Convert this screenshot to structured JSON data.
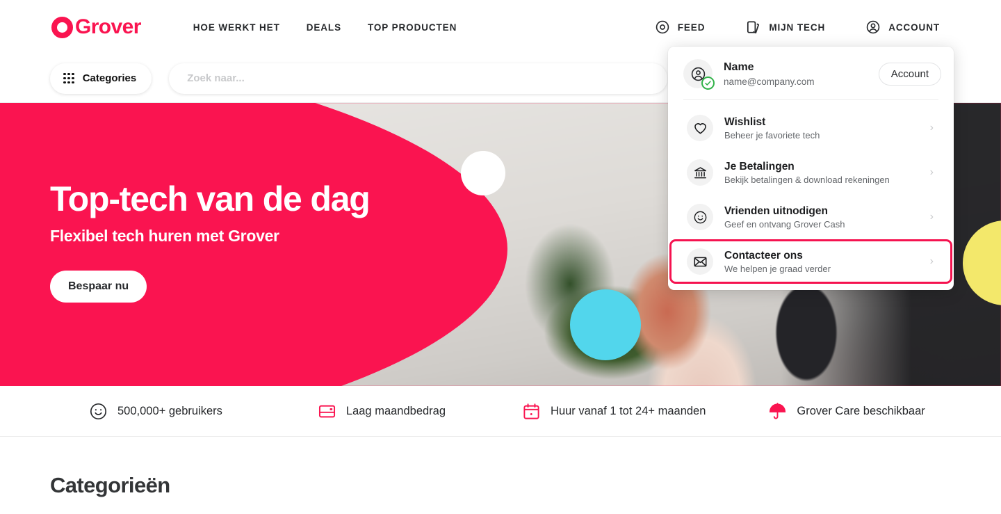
{
  "brand": {
    "name": "Grover",
    "logo_icon": "grover-ring-logo",
    "pink": "#FA1450",
    "cyan": "#52D6EC",
    "yellow": "#F3E86B",
    "highlight": "#F5124F"
  },
  "header": {
    "nav": [
      {
        "label": "HOE WERKT HET"
      },
      {
        "label": "DEALS"
      },
      {
        "label": "TOP PRODUCTEN"
      }
    ],
    "right": [
      {
        "label": "FEED",
        "icon": "feed-icon"
      },
      {
        "label": "MIJN TECH",
        "icon": "cards-icon"
      },
      {
        "label": "ACCOUNT",
        "icon": "account-icon"
      }
    ]
  },
  "searchbar": {
    "categories_label": "Categories",
    "categories_icon": "grid-dots-icon",
    "placeholder": "Zoek naar...",
    "value": ""
  },
  "hero": {
    "title": "Top-tech van de dag",
    "subtitle": "Flexibel tech huren met Grover",
    "cta": "Bespaar nu"
  },
  "features": [
    {
      "label": "500,000+ gebruikers",
      "icon": "smiley-icon",
      "color": "#26282B"
    },
    {
      "label": "Laag maandbedrag",
      "icon": "card-icon",
      "color": "#FA1450"
    },
    {
      "label": "Huur vanaf 1 tot 24+ maanden",
      "icon": "calendar-icon",
      "color": "#FA1450"
    },
    {
      "label": "Grover Care beschikbaar",
      "icon": "umbrella-icon",
      "color": "#FA1450"
    }
  ],
  "categories_section": {
    "heading": "Categorieën"
  },
  "account_dropdown": {
    "user": {
      "name": "Name",
      "email": "name@company.com",
      "avatar_icon": "account-avatar-icon",
      "verified_icon": "check-badge-icon"
    },
    "account_button": "Account",
    "items": [
      {
        "title": "Wishlist",
        "description": "Beheer je favoriete tech",
        "icon": "heart-icon",
        "chevron": "›",
        "highlighted": false
      },
      {
        "title": "Je Betalingen",
        "description": "Bekijk betalingen & download rekeningen",
        "icon": "bank-icon",
        "chevron": "›",
        "highlighted": false
      },
      {
        "title": "Vrienden uitnodigen",
        "description": "Geef en ontvang Grover Cash",
        "icon": "smiley-icon",
        "chevron": "›",
        "highlighted": false
      },
      {
        "title": "Contacteer ons",
        "description": "We helpen je graad verder",
        "icon": "envelope-icon",
        "chevron": "›",
        "highlighted": true
      }
    ]
  }
}
